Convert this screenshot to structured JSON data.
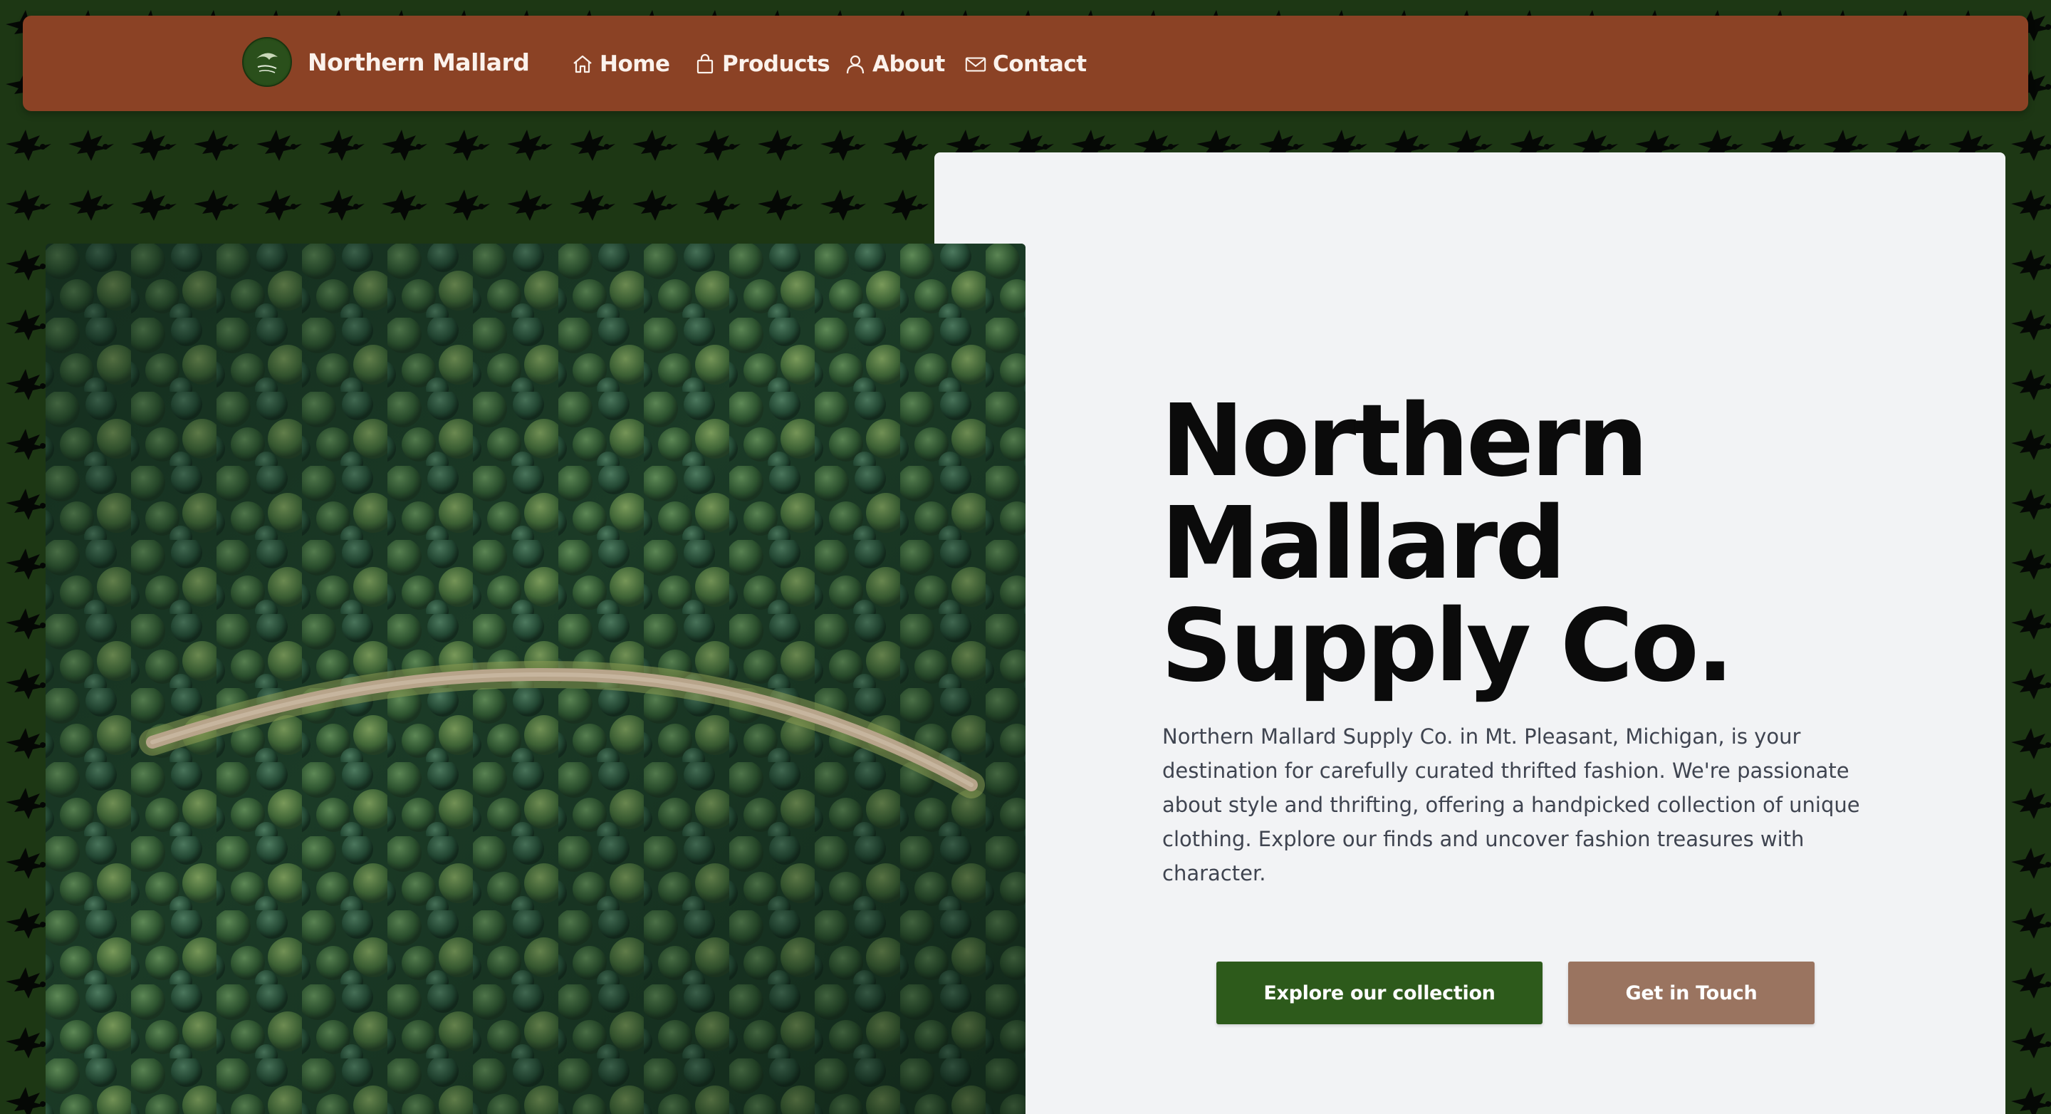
{
  "navbar": {
    "brand": "Northern Mallard",
    "logo_icon": "mallard-logo-icon",
    "items": [
      {
        "label": "Home",
        "icon": "home-icon"
      },
      {
        "label": "Products",
        "icon": "shopping-bag-icon"
      },
      {
        "label": "About",
        "icon": "user-icon"
      },
      {
        "label": "Contact",
        "icon": "mail-icon"
      }
    ]
  },
  "hero": {
    "title": "Northern Mallard Supply Co.",
    "description": "Northern Mallard Supply Co. in Mt. Pleasant, Michigan, is your destination for carefully curated thrifted fashion. We're passionate about style and thrifting, offering a handpicked collection of unique clothing. Explore our finds and uncover fashion treasures with character.",
    "primary_button": "Explore our collection",
    "secondary_button": "Get in Touch",
    "image": "aerial-forest-road-image"
  },
  "colors": {
    "page_background": "#1d3714",
    "navbar": "#8b4225",
    "card_background": "#f2f3f5",
    "primary_button": "#2d5a1b",
    "secondary_button": "#9a7460",
    "title_text": "#0b0b0b",
    "body_text": "#3f4450"
  }
}
